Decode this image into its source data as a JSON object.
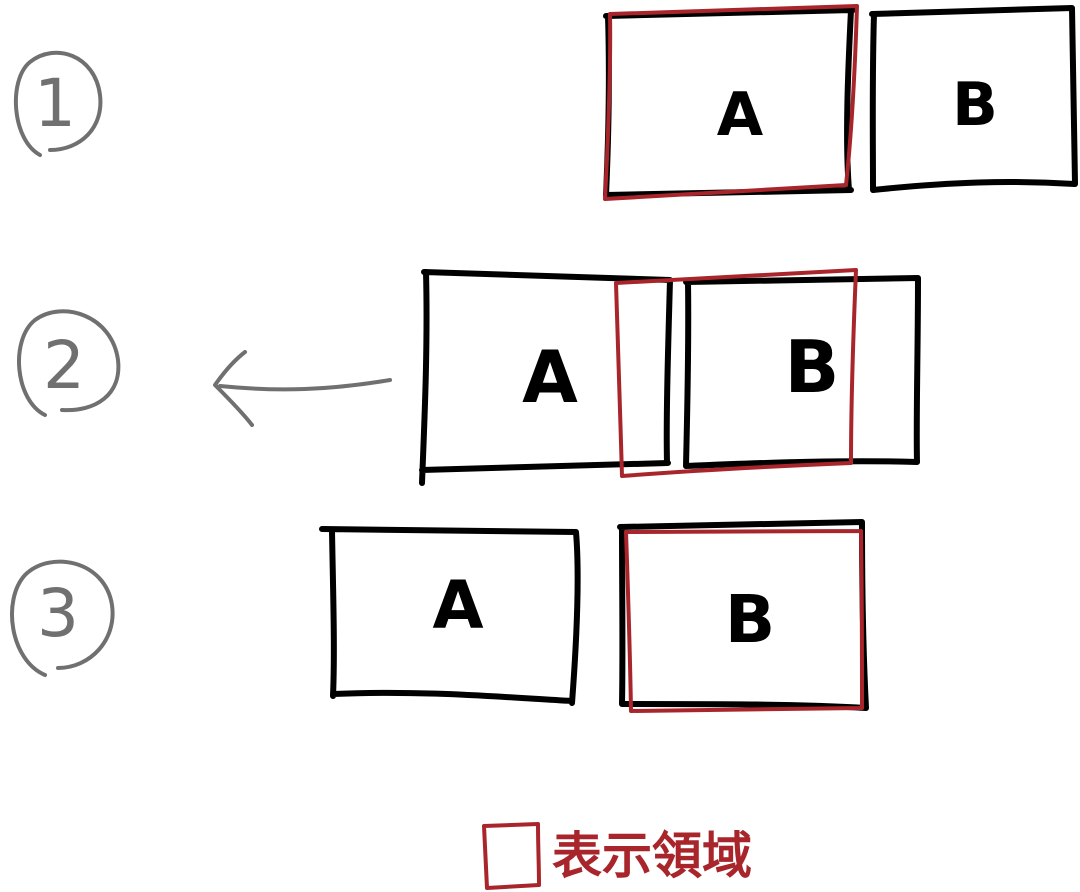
{
  "steps": [
    {
      "number": "1",
      "left_label": "A",
      "right_label": "B",
      "highlighted": "A"
    },
    {
      "number": "2",
      "left_label": "A",
      "right_label": "B",
      "highlighted": "between A and B",
      "arrow_direction": "left"
    },
    {
      "number": "3",
      "left_label": "A",
      "right_label": "B",
      "highlighted": "B"
    }
  ],
  "legend": {
    "label": "表示領域"
  },
  "colors": {
    "ink": "#000000",
    "viewport": "#a8252b",
    "step_markers": "#707070",
    "background": "#ffffff"
  }
}
